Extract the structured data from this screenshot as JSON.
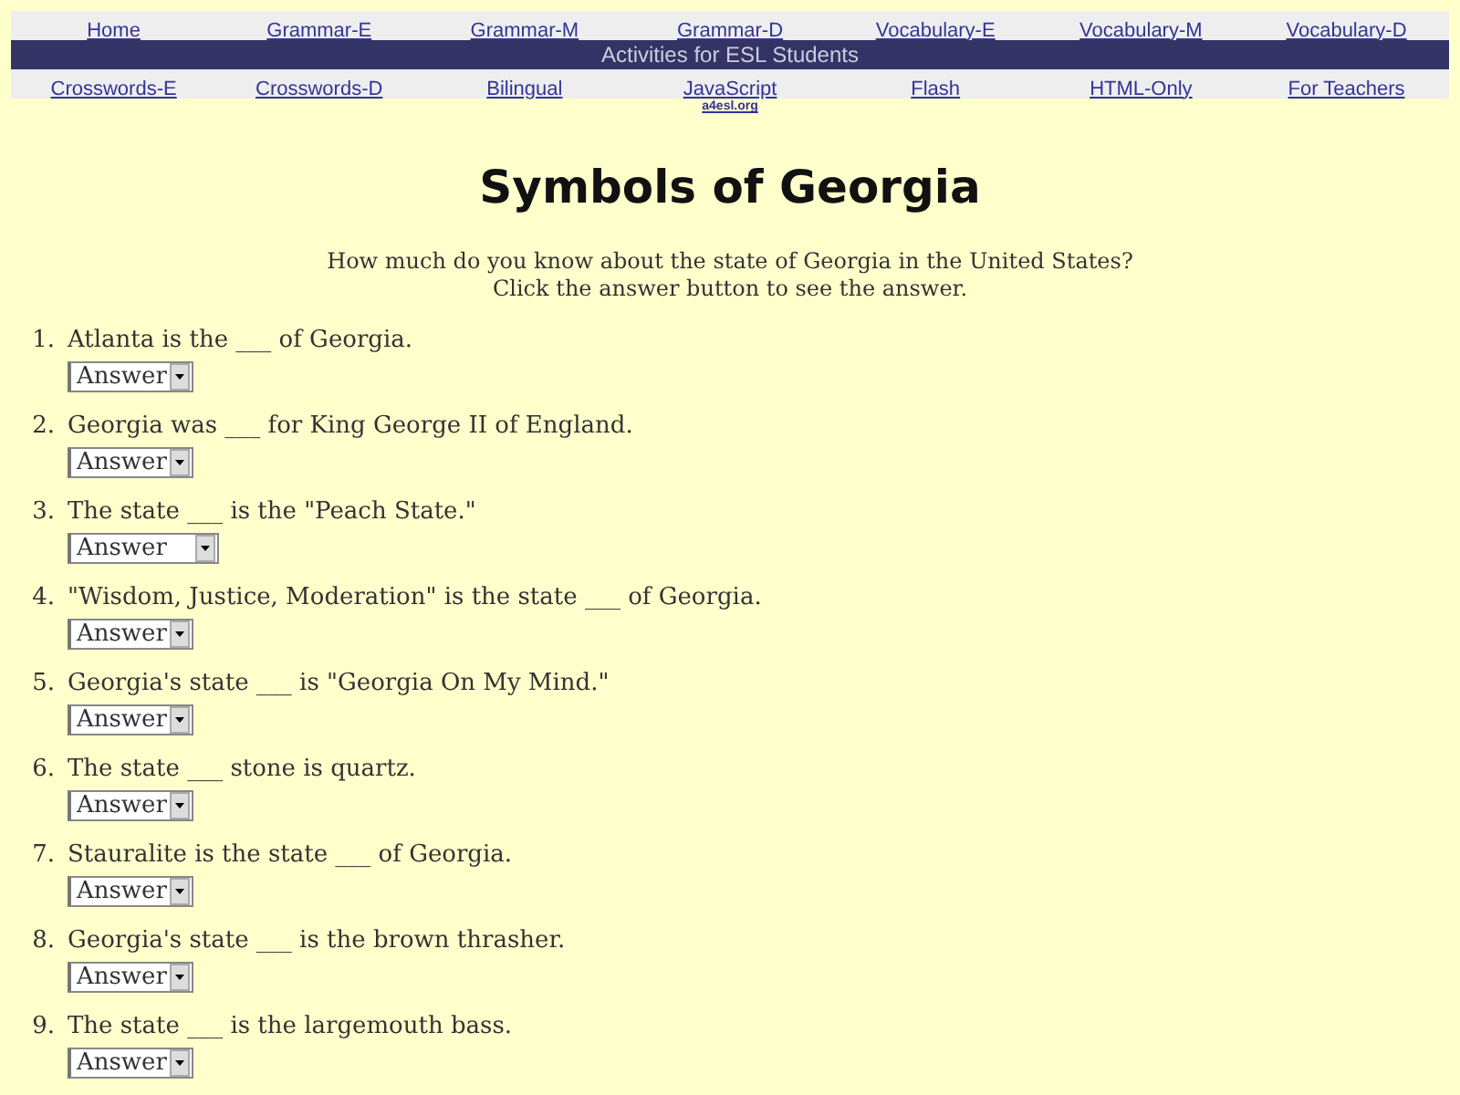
{
  "nav_top": [
    "Home",
    "Grammar-E",
    "Grammar-M",
    "Grammar-D",
    "Vocabulary-E",
    "Vocabulary-M",
    "Vocabulary-D"
  ],
  "banner": "Activities for ESL Students",
  "nav_bottom": [
    "Crosswords-E",
    "Crosswords-D",
    "Bilingual",
    "JavaScript",
    "Flash",
    "HTML-Only",
    "For Teachers"
  ],
  "site_link": "a4esl.org",
  "title": "Symbols of Georgia",
  "intro": [
    "How much do you know about the state of Georgia in the United States?",
    "Click the answer button to see the answer."
  ],
  "questions": [
    {
      "number": "1.",
      "text": "Atlanta is the ___ of Georgia.",
      "answer": "Answer"
    },
    {
      "number": "2.",
      "text": "Georgia was ___ for King George II of England.",
      "answer": "Answer"
    },
    {
      "number": "3.",
      "text": "The state ___ is the \"Peach State.\"",
      "answer": "Answer"
    },
    {
      "number": "4.",
      "text": "\"Wisdom, Justice, Moderation\" is the state ___ of Georgia.",
      "answer": "Answer"
    },
    {
      "number": "5.",
      "text": "Georgia's state ___ is \"Georgia On My Mind.\"",
      "answer": "Answer"
    },
    {
      "number": "6.",
      "text": "The state ___ stone is quartz.",
      "answer": "Answer"
    },
    {
      "number": "7.",
      "text": "Stauralite is the state ___ of Georgia.",
      "answer": "Answer"
    },
    {
      "number": "8.",
      "text": "Georgia's state ___ is the brown thrasher.",
      "answer": "Answer"
    },
    {
      "number": "9.",
      "text": "The state ___ is the largemouth bass.",
      "answer": "Answer"
    }
  ]
}
